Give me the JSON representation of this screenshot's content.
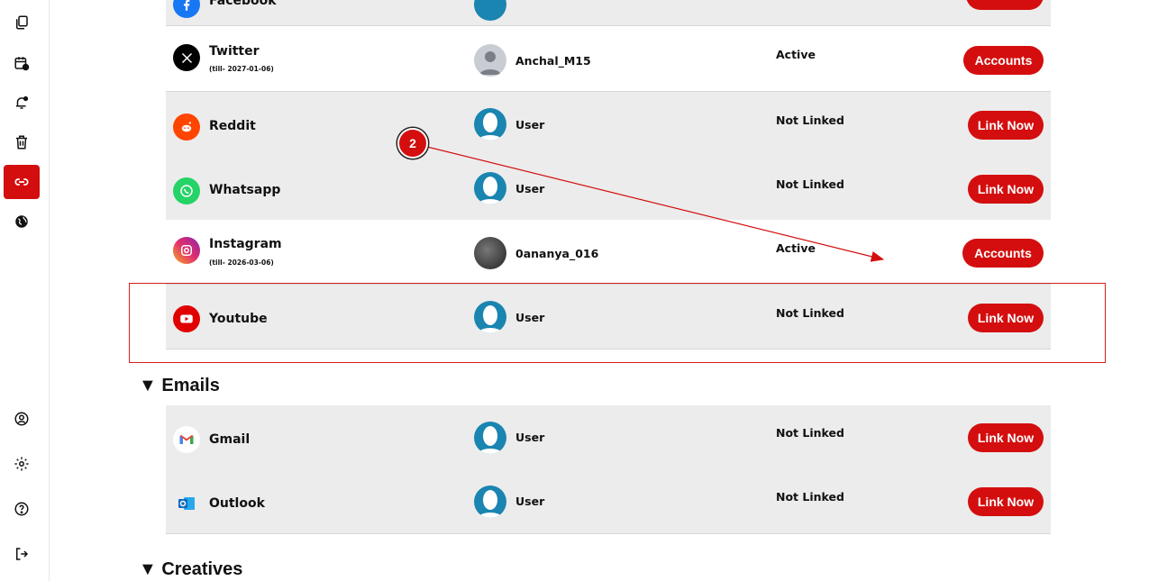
{
  "social_rows": [
    {
      "name": "Twitter",
      "sub": "(till- 2027-01-06)",
      "user": "Anchal_M15",
      "status": "Active",
      "action": "Accounts"
    },
    {
      "name": "Reddit",
      "sub": "",
      "user": "User",
      "status": "Not Linked",
      "action": "Link Now"
    },
    {
      "name": "Whatsapp",
      "sub": "",
      "user": "User",
      "status": "Not Linked",
      "action": "Link Now"
    },
    {
      "name": "Instagram",
      "sub": "(till- 2026-03-06)",
      "user": "0ananya_016",
      "status": "Active",
      "action": "Accounts"
    },
    {
      "name": "Youtube",
      "sub": "",
      "user": "User",
      "status": "Not Linked",
      "action": "Link Now"
    }
  ],
  "top_partial": {
    "name": "Facebook"
  },
  "sections": {
    "emails": "Emails",
    "creatives": "Creatives"
  },
  "email_rows": [
    {
      "name": "Gmail",
      "user": "User",
      "status": "Not Linked",
      "action": "Link Now"
    },
    {
      "name": "Outlook",
      "user": "User",
      "status": "Not Linked",
      "action": "Link Now"
    }
  ],
  "annotation": {
    "step": "2"
  },
  "sidebar_icons": [
    "copy-icon",
    "calendar-clock-icon",
    "bell-icon",
    "trash-icon",
    "link-icon",
    "globe-icon",
    "user-circle-icon",
    "gear-icon",
    "help-icon",
    "logout-icon"
  ],
  "colors": {
    "accent": "#d40e0e",
    "row_shaded": "#ececec"
  }
}
